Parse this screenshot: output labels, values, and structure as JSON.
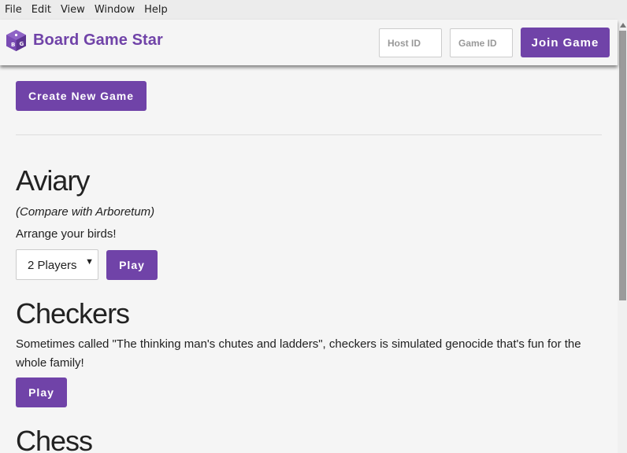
{
  "menubar": {
    "items": [
      "File",
      "Edit",
      "View",
      "Window",
      "Help"
    ]
  },
  "navbar": {
    "brand": "Board Game Star",
    "host_placeholder": "Host ID",
    "game_placeholder": "Game ID",
    "join_label": "Join Game"
  },
  "actions": {
    "create_label": "Create New Game"
  },
  "games": [
    {
      "title": "Aviary",
      "note": "(Compare with Arboretum)",
      "description": "Arrange your birds!",
      "players": "2 Players",
      "play_label": "Play"
    },
    {
      "title": "Checkers",
      "description": "Sometimes called \"The thinking man's chutes and ladders\", checkers is simulated genocide that's fun for the whole family!",
      "play_label": "Play"
    },
    {
      "title": "Chess"
    }
  ],
  "colors": {
    "accent": "#7043a8",
    "background": "#f5f5f5"
  }
}
